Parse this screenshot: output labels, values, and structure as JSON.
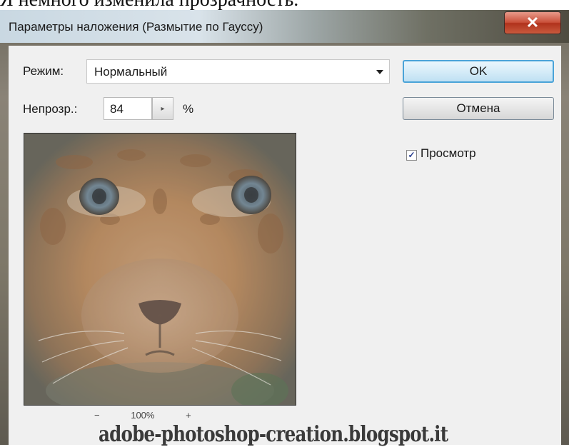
{
  "caption": "Я немного изменила прозрачность.",
  "dialog": {
    "title": "Параметры наложения (Размытие по Гауссу)",
    "close_glyph": "✕",
    "mode": {
      "label": "Режим:",
      "value": "Нормальный"
    },
    "opacity": {
      "label": "Непрозр.:",
      "value": "84",
      "unit": "%"
    },
    "buttons": {
      "ok": "OK",
      "cancel": "Отмена"
    },
    "preview_checkbox": {
      "label": "Просмотр",
      "checked": true
    },
    "zoom": {
      "minus": "−",
      "value": "100%",
      "plus": "+"
    }
  },
  "watermark": "adobe-photoshop-creation.blogspot.it",
  "icons": [
    "close-icon",
    "chevron-down-icon",
    "stepper-arrow-icon",
    "checkmark-icon"
  ],
  "colors": {
    "ok_border": "#4aa3d8",
    "close_red": "#c9503a"
  }
}
